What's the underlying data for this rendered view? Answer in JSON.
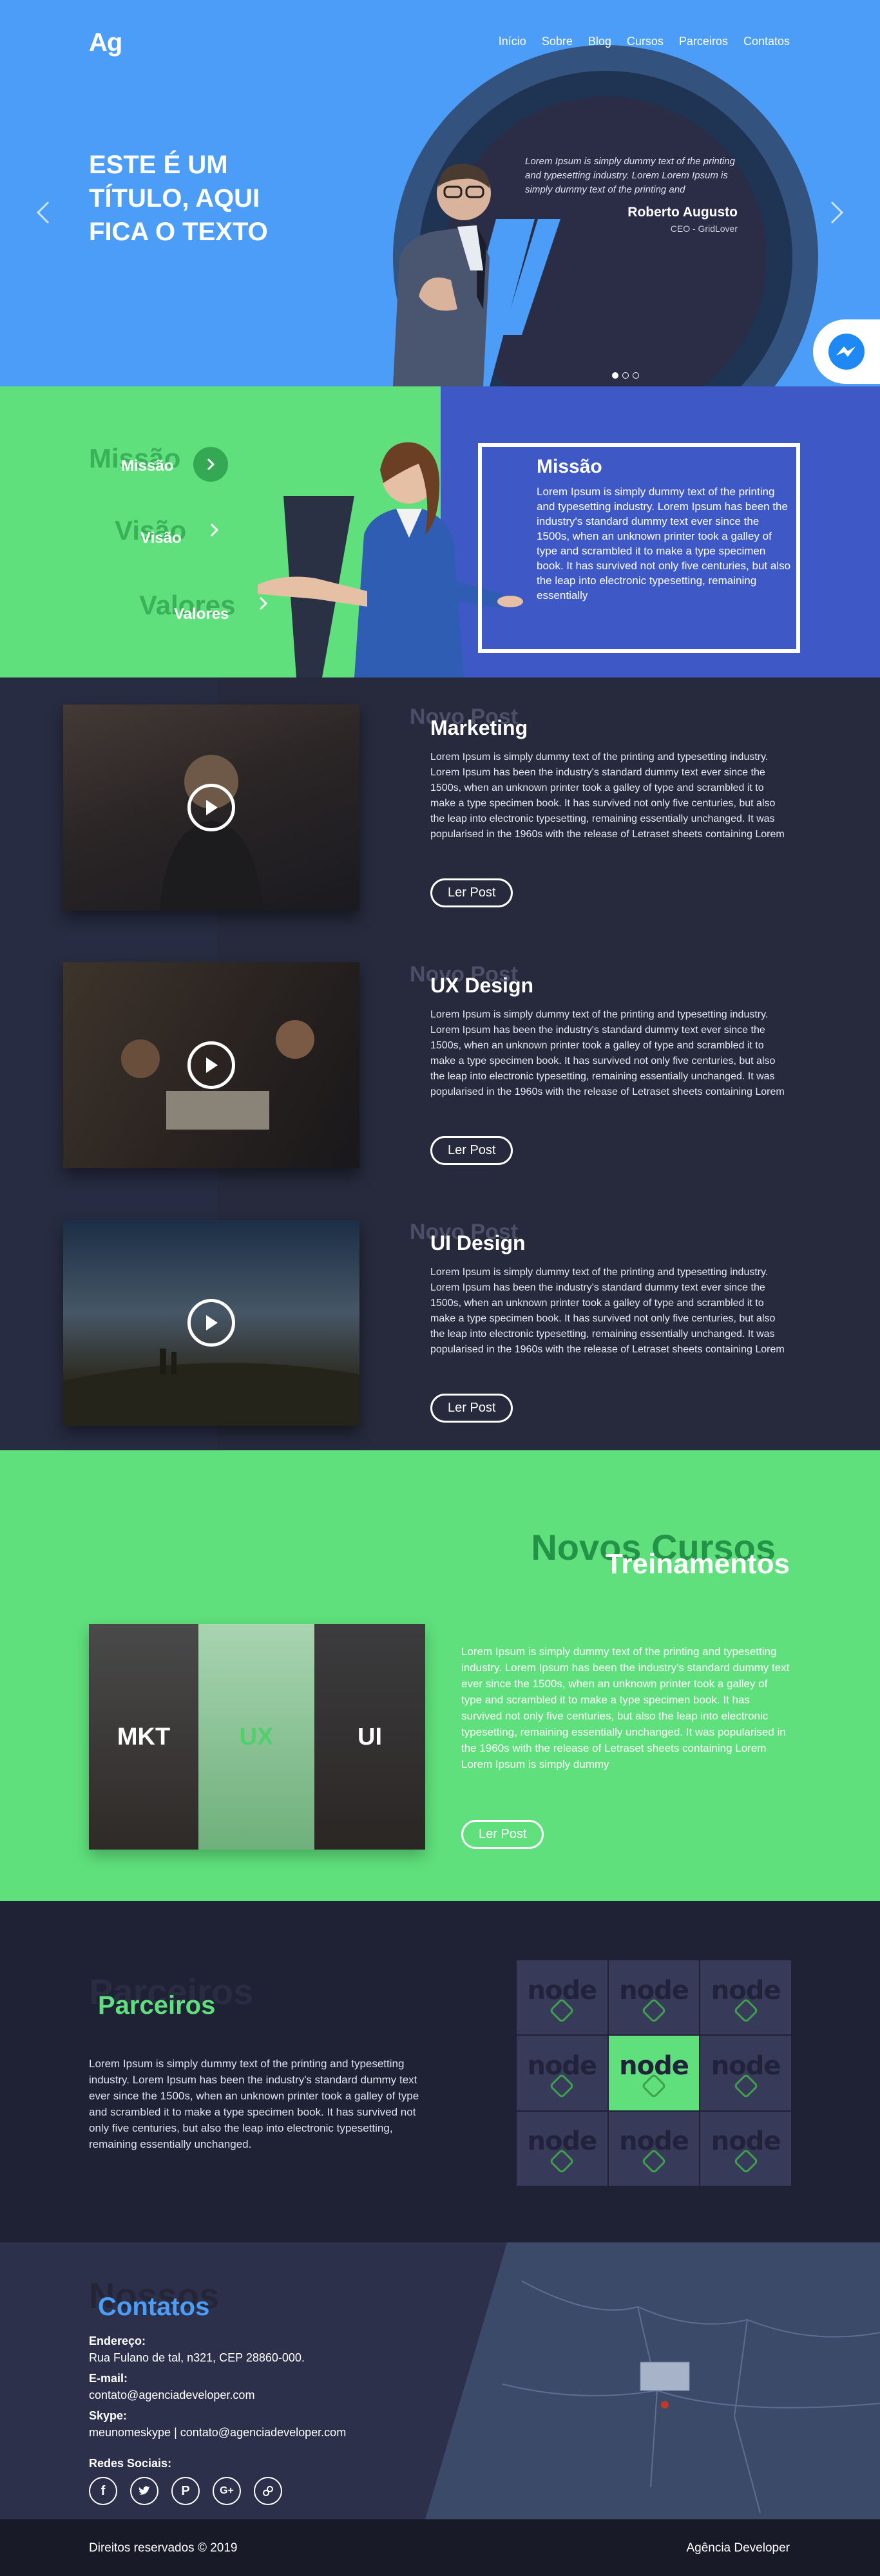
{
  "header": {
    "logo": "Ag",
    "nav": [
      "Início",
      "Sobre",
      "Blog",
      "Cursos",
      "Parceiros",
      "Contatos"
    ]
  },
  "hero": {
    "title": "ESTE É UM TÍTULO, AQUI FICA O TEXTO",
    "quote": "Lorem Ipsum is simply dummy text of the printing and typesetting industry. Lorem Lorem Ipsum is simply dummy text of the printing and",
    "name": "Roberto Augusto",
    "role": "CEO - GridLover",
    "prev_icon": "chevron-left-icon",
    "next_icon": "chevron-right-icon",
    "messenger_icon": "messenger-icon"
  },
  "about": {
    "ghost": [
      "Missão",
      "Visão",
      "Valores"
    ],
    "labels": [
      "Missão",
      "Visão",
      "Valores"
    ],
    "box_title": "Missão",
    "box_text": "Lorem Ipsum is simply dummy text of the printing and typesetting industry. Lorem Ipsum has been the industry's standard dummy text ever since the 1500s, when an unknown printer took a galley of type and scrambled it to make a type specimen book. It has survived not only five centuries, but also the leap into electronic typesetting, remaining essentially"
  },
  "posts": [
    {
      "ghost": "Novo Post",
      "title": "Marketing",
      "text": "Lorem Ipsum is simply dummy text of the printing and typesetting industry. Lorem Ipsum has been the industry's standard dummy text ever since the 1500s, when an unknown printer took a galley of type and scrambled it to make a type specimen book. It has survived not only five centuries, but also the leap into electronic typesetting, remaining essentially unchanged. It was popularised in the 1960s with the release of Letraset sheets containing Lorem",
      "button": "Ler Post"
    },
    {
      "ghost": "Novo Post",
      "title": "UX Design",
      "text": "Lorem Ipsum is simply dummy text of the printing and typesetting industry. Lorem Ipsum has been the industry's standard dummy text ever since the 1500s, when an unknown printer took a galley of type and scrambled it to make a type specimen book. It has survived not only five centuries, but also the leap into electronic typesetting, remaining essentially unchanged. It was popularised in the 1960s with the release of Letraset sheets containing Lorem",
      "button": "Ler Post"
    },
    {
      "ghost": "Novo Post",
      "title": "UI Design",
      "text": "Lorem Ipsum is simply dummy text of the printing and typesetting industry. Lorem Ipsum has been the industry's standard dummy text ever since the 1500s, when an unknown printer took a galley of type and scrambled it to make a type specimen book. It has survived not only five centuries, but also the leap into electronic typesetting, remaining essentially unchanged. It was popularised in the 1960s with the release of Letraset sheets containing Lorem",
      "button": "Ler Post"
    }
  ],
  "cursos": {
    "ghost": "Novos Cursos",
    "title": "Treinamentos",
    "courses": [
      "MKT",
      "UX",
      "UI"
    ],
    "text": "Lorem Ipsum is simply dummy text of the printing and typesetting industry. Lorem Ipsum has been the industry's standard dummy text ever since the 1500s, when an unknown printer took a galley of type and scrambled it to make a type specimen book. It has survived not only five centuries, but also the leap into electronic typesetting, remaining essentially unchanged. It was popularised in the 1960s with the release of Letraset sheets containing Lorem Lorem Ipsum is simply dummy",
    "button": "Ler Post"
  },
  "parceiros": {
    "ghost": "Parceiros",
    "title": "Parceiros",
    "text": "Lorem Ipsum is simply dummy text of the printing and typesetting industry. Lorem Ipsum has been the industry's standard dummy text ever since the 1500s, when an unknown printer took a galley of type and scrambled it to make a type specimen book. It has survived not only five centuries, but also the leap into electronic typesetting, remaining essentially unchanged.",
    "logo_text": "node"
  },
  "contatos": {
    "ghost": "Nossos",
    "title": "Contatos",
    "address_label": "Endereço:",
    "address": "Rua Fulano de tal, n321, CEP 28860-000.",
    "email_label": "E-mail:",
    "email": "contato@agenciadeveloper.com",
    "skype_label": "Skype:",
    "skype": "meunomeskype | contato@agenciadeveloper.com",
    "social_label": "Redes Sociais:",
    "social_icons": [
      "facebook-icon",
      "twitter-icon",
      "pinterest-icon",
      "google-plus-icon",
      "link-icon"
    ]
  },
  "footer": {
    "rights": "Direitos reservados © 2019",
    "brand": "Agência Developer"
  },
  "colors": {
    "blue": "#4b9df7",
    "green": "#5fe07c",
    "dark": "#1f2135",
    "indigo": "#3e58c5"
  }
}
